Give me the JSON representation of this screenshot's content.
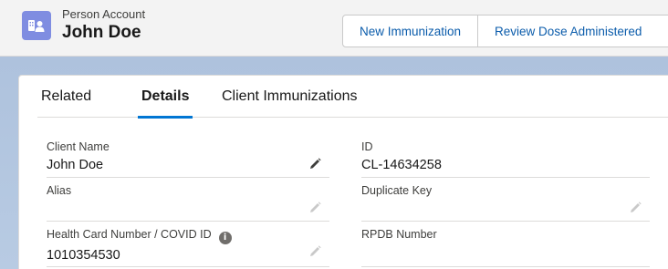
{
  "header": {
    "object_label": "Person Account",
    "record_name": "John Doe",
    "object_icon": "person-account-icon",
    "icon_color": "#7f8de1"
  },
  "actions": {
    "new_immunization": "New Immunization",
    "review_dose": "Review Dose Administered"
  },
  "tabs": [
    {
      "label": "Related",
      "active": false
    },
    {
      "label": "Details",
      "active": true
    },
    {
      "label": "Client Immunizations",
      "active": false
    }
  ],
  "fields": {
    "client_name": {
      "label": "Client Name",
      "value": "John Doe"
    },
    "id": {
      "label": "ID",
      "value": "CL-14634258"
    },
    "alias": {
      "label": "Alias",
      "value": ""
    },
    "duplicate_key": {
      "label": "Duplicate Key",
      "value": ""
    },
    "health_card": {
      "label": "Health Card Number / COVID ID",
      "value": "1010354530"
    },
    "rpdb_number": {
      "label": "RPDB Number",
      "value": ""
    }
  },
  "colors": {
    "accent": "#0176d3",
    "link": "#0b5cab",
    "background": "#b0c4df"
  }
}
